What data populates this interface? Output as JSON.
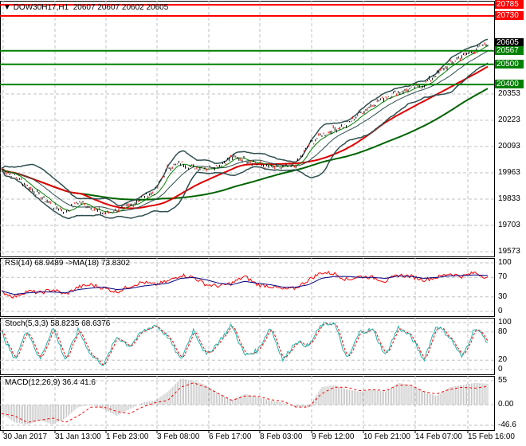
{
  "header": {
    "symbol": "DOW30H17,H1",
    "ohlc": "20607 20607 20602 20605"
  },
  "colors": {
    "resistance": "#ff0000",
    "support": "#008000",
    "rsi": "#ff0000",
    "rsi_ma": "#000080",
    "stoch_main": "#20b2aa",
    "stoch_signal": "#ff0000",
    "macd_hist": "#c0c0c0",
    "macd_signal": "#ff0000"
  },
  "levels": [
    {
      "value": 20785,
      "label": "20785",
      "color": "#ff0000"
    },
    {
      "value": 20730,
      "label": "20730",
      "color": "#ff0000"
    },
    {
      "value": 20605,
      "label": "20605",
      "color": "#000000"
    },
    {
      "value": 20567,
      "label": "20567",
      "color": "#008000"
    },
    {
      "value": 20500,
      "label": "20500",
      "color": "#008000"
    },
    {
      "value": 20400,
      "label": "20400",
      "color": "#008000"
    }
  ],
  "chart_data": [
    {
      "type": "line",
      "title": "DOW30H17,H1",
      "ylim": [
        19573,
        20810
      ],
      "yticks": [
        "20353",
        "20223",
        "20093",
        "19963",
        "19833",
        "19703",
        "19573"
      ],
      "yticks_values": [
        20353,
        20223,
        20093,
        19963,
        19833,
        19703,
        19573
      ],
      "close": [
        19980,
        19950,
        19900,
        19850,
        19800,
        19770,
        19820,
        19790,
        19760,
        19780,
        19800,
        19840,
        19870,
        19990,
        20010,
        19990,
        19985,
        20000,
        20040,
        20030,
        20010,
        19990,
        19990,
        20000,
        20100,
        20150,
        20180,
        20200,
        20260,
        20300,
        20340,
        20360,
        20380,
        20400,
        20450,
        20500,
        20540,
        20570,
        20605
      ]
    },
    {
      "type": "line",
      "title": "RSI(14) 68.9489  ->MA(18) 73.8302",
      "ylim": [
        0,
        100
      ],
      "yticks": [
        "100",
        "70",
        "30",
        "0"
      ],
      "yticks_values": [
        100,
        70,
        30,
        0
      ],
      "series": [
        {
          "name": "RSI",
          "values": [
            40,
            30,
            42,
            38,
            45,
            35,
            50,
            55,
            48,
            40,
            52,
            60,
            55,
            62,
            75,
            70,
            55,
            52,
            58,
            72,
            55,
            52,
            45,
            48,
            65,
            80,
            78,
            65,
            72,
            70,
            62,
            75,
            72,
            65,
            70,
            78,
            72,
            80,
            69
          ]
        },
        {
          "name": "MA",
          "values": [
            42,
            35,
            38,
            40,
            40,
            38,
            45,
            48,
            50,
            45,
            47,
            52,
            55,
            58,
            68,
            70,
            65,
            58,
            55,
            62,
            58,
            55,
            50,
            50,
            55,
            68,
            72,
            72,
            70,
            70,
            68,
            73,
            72,
            68,
            70,
            73,
            74,
            75,
            74
          ]
        }
      ]
    },
    {
      "type": "line",
      "title": "Stoch(5,3,3) 58.8235 68.6376",
      "ylim": [
        0,
        100
      ],
      "yticks": [
        "100",
        "80",
        "20",
        "0"
      ],
      "yticks_values": [
        100,
        80,
        20,
        0
      ],
      "series": [
        {
          "name": "main",
          "values": [
            80,
            20,
            85,
            20,
            90,
            20,
            85,
            30,
            10,
            70,
            50,
            80,
            95,
            70,
            20,
            85,
            30,
            60,
            95,
            30,
            40,
            90,
            20,
            60,
            50,
            95,
            100,
            20,
            80,
            85,
            30,
            90,
            70,
            20,
            95,
            70,
            25,
            90,
            59
          ]
        }
      ]
    },
    {
      "type": "bar",
      "title": "MACD(12,26,9) 36.4 41.6",
      "ylim": [
        -46.6,
        55
      ],
      "yticks": [
        "55",
        "0.00",
        "-46.6"
      ],
      "yticks_values": [
        55,
        0,
        -46.6
      ],
      "series": [
        {
          "name": "histogram",
          "values": [
            -20,
            -40,
            -45,
            -35,
            -45,
            -30,
            -5,
            0,
            -10,
            -25,
            -10,
            5,
            10,
            30,
            60,
            55,
            45,
            25,
            10,
            25,
            18,
            10,
            5,
            -5,
            -5,
            40,
            45,
            35,
            30,
            35,
            30,
            50,
            45,
            30,
            20,
            40,
            45,
            50,
            48
          ]
        },
        {
          "name": "signal",
          "values": [
            -20,
            -25,
            -40,
            -35,
            -30,
            -40,
            -25,
            -5,
            -5,
            -15,
            -20,
            -5,
            5,
            10,
            40,
            50,
            40,
            25,
            10,
            20,
            20,
            12,
            8,
            -5,
            -5,
            25,
            40,
            40,
            32,
            35,
            32,
            45,
            45,
            30,
            25,
            35,
            40,
            38,
            42
          ]
        }
      ]
    }
  ],
  "time_axis": [
    "30 Jan 2017",
    "31 Jan 13:00",
    "1 Feb 23:00",
    "3 Feb 08:00",
    "6 Feb 17:00",
    "8 Feb 03:00",
    "9 Feb 12:00",
    "10 Feb 21:00",
    "14 Feb 07:00",
    "15 Feb 16:00"
  ]
}
